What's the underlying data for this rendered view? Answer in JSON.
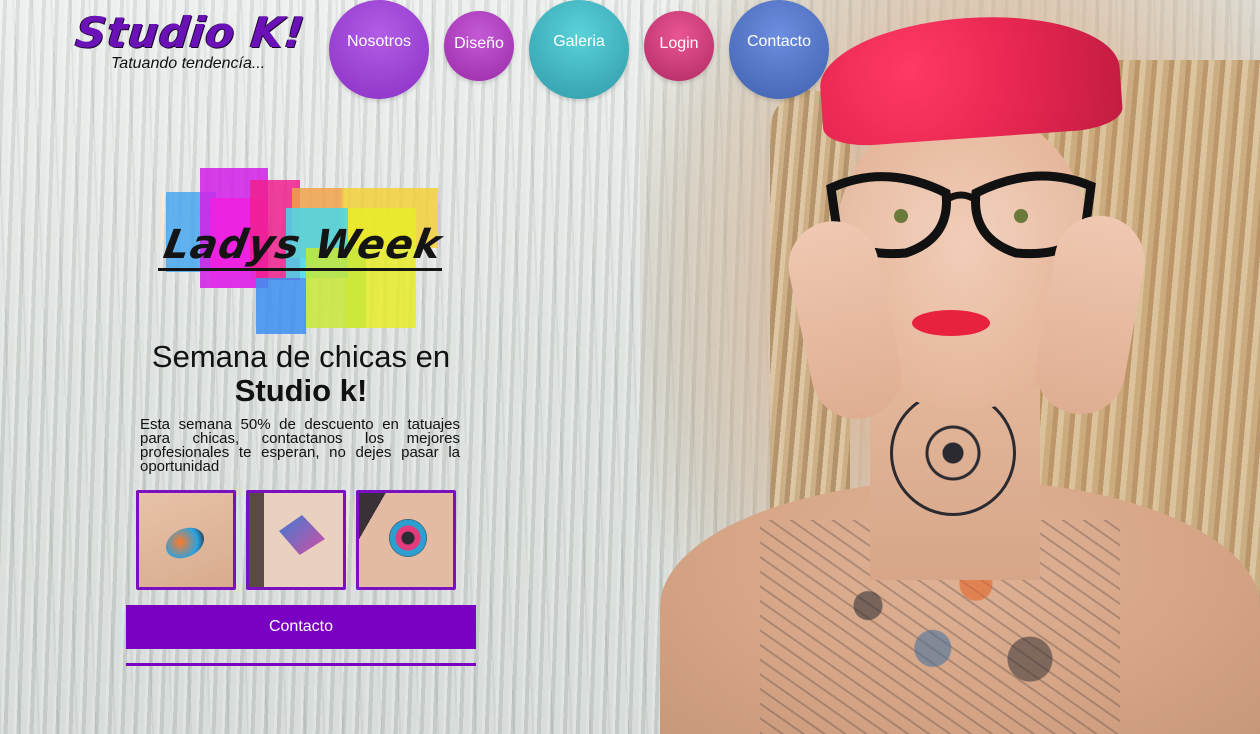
{
  "header": {
    "logo": "Studio K!",
    "tagline": "Tatuando tendencía..."
  },
  "nav": {
    "items": [
      {
        "label": "Nosotros",
        "color": "#9b45d6"
      },
      {
        "label": "Diseño",
        "color": "#b23fc0"
      },
      {
        "label": "Galeria",
        "color": "#41b6c2"
      },
      {
        "label": "Login",
        "color": "#d03c7b"
      },
      {
        "label": "Contacto",
        "color": "#5677c8"
      }
    ]
  },
  "promo": {
    "badge_title": "Ladys Week",
    "headline_line1": "Semana de chicas en",
    "headline_line2": "Studio k!",
    "description": "Esta semana 50% de descuento en tatuajes para chicas, contactanos los mejores profesionales te esperan, no dejes pasar la oportunidad",
    "thumbnails": [
      "watercolor-forearm-tattoo",
      "geometric-bird-tattoo",
      "watercolor-rose-tattoo"
    ],
    "contact_button": "Contacto"
  },
  "colors": {
    "accent": "#7a00c2",
    "brand_logo": "#6a12b8"
  }
}
